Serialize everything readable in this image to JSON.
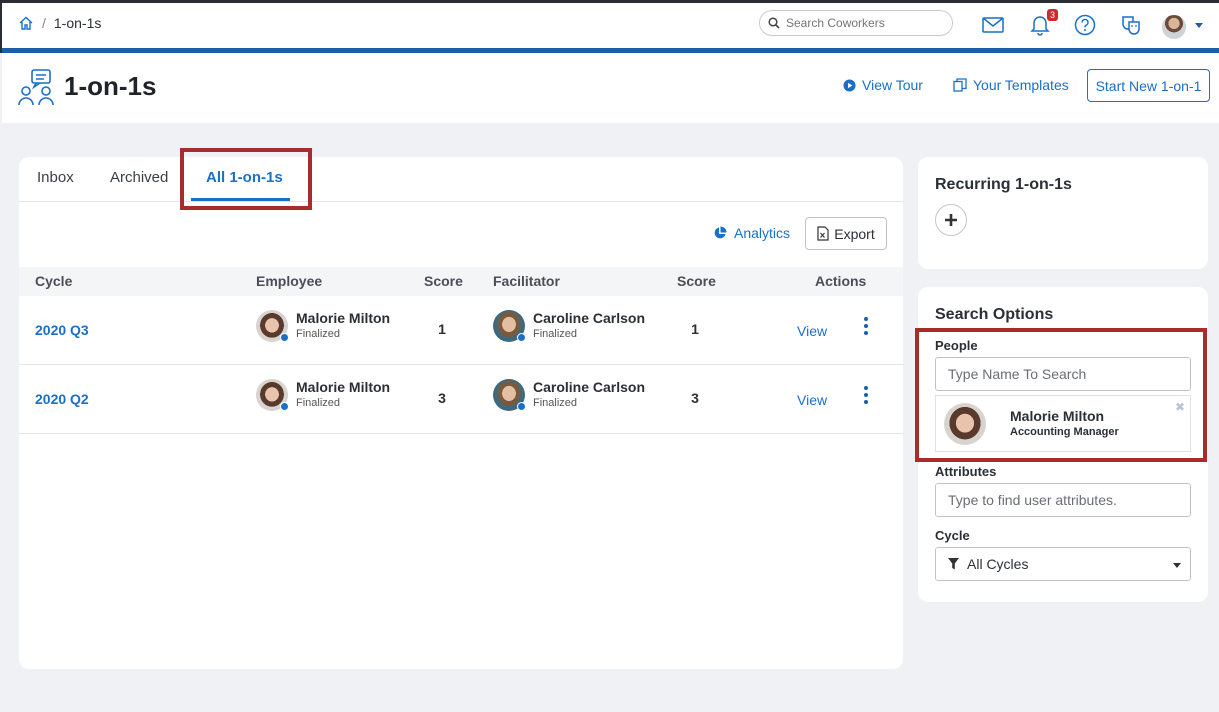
{
  "breadcrumb": {
    "current": "1-on-1s",
    "separator": "/"
  },
  "search": {
    "placeholder": "Search Coworkers"
  },
  "notifications": {
    "count": "3"
  },
  "page": {
    "title": "1-on-1s",
    "view_tour": "View Tour",
    "your_templates": "Your Templates",
    "start_new": "Start New 1-on-1"
  },
  "tabs": [
    {
      "label": "Inbox"
    },
    {
      "label": "Archived"
    },
    {
      "label": "All 1-on-1s",
      "active": true
    }
  ],
  "toolbar": {
    "analytics": "Analytics",
    "export": "Export"
  },
  "table": {
    "headers": {
      "cycle": "Cycle",
      "employee": "Employee",
      "score": "Score",
      "facilitator": "Facilitator",
      "score2": "Score",
      "actions": "Actions"
    },
    "rows": [
      {
        "cycle": "2020 Q3",
        "employee": "Malorie Milton",
        "employee_status": "Finalized",
        "employee_score": "1",
        "facilitator": "Caroline Carlson",
        "facilitator_status": "Finalized",
        "facilitator_score": "1",
        "action": "View"
      },
      {
        "cycle": "2020 Q2",
        "employee": "Malorie Milton",
        "employee_status": "Finalized",
        "employee_score": "3",
        "facilitator": "Caroline Carlson",
        "facilitator_status": "Finalized",
        "facilitator_score": "3",
        "action": "View"
      }
    ]
  },
  "recurring": {
    "title": "Recurring 1-on-1s"
  },
  "search_options": {
    "title": "Search Options",
    "people_label": "People",
    "people_placeholder": "Type Name To Search",
    "selected_person": {
      "name": "Malorie Milton",
      "role": "Accounting Manager"
    },
    "attributes_label": "Attributes",
    "attributes_placeholder": "Type to find user attributes.",
    "cycle_label": "Cycle",
    "cycle_value": "All Cycles"
  },
  "colors": {
    "accent": "#1a6fc9",
    "brand_bar": "#1a5fa8",
    "highlight": "#a82c2c",
    "badge": "#d0282e"
  }
}
